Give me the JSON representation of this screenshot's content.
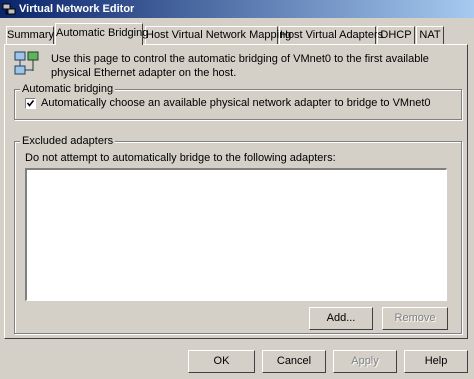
{
  "window": {
    "title": "Virtual Network Editor",
    "icon": "network-editor-icon"
  },
  "tabs": [
    {
      "label": "Summary",
      "active": false
    },
    {
      "label": "Automatic Bridging",
      "active": true
    },
    {
      "label": "Host Virtual Network Mapping",
      "active": false
    },
    {
      "label": "Host Virtual Adapters",
      "active": false
    },
    {
      "label": "DHCP",
      "active": false
    },
    {
      "label": "NAT",
      "active": false
    }
  ],
  "page": {
    "description": "Use this page to control the automatic bridging of VMnet0 to the first available physical Ethernet adapter on the host.",
    "icon": "network-adapters-icon"
  },
  "automatic_bridging": {
    "group_label": "Automatic bridging",
    "checkbox_label": "Automatically choose an available physical network adapter to bridge to VMnet0",
    "checked": true
  },
  "excluded_adapters": {
    "group_label": "Excluded adapters",
    "description": "Do not attempt to automatically bridge to the following adapters:",
    "items": [],
    "add_label": "Add...",
    "remove_label": "Remove"
  },
  "footer": {
    "ok_label": "OK",
    "cancel_label": "Cancel",
    "apply_label": "Apply",
    "help_label": "Help"
  }
}
